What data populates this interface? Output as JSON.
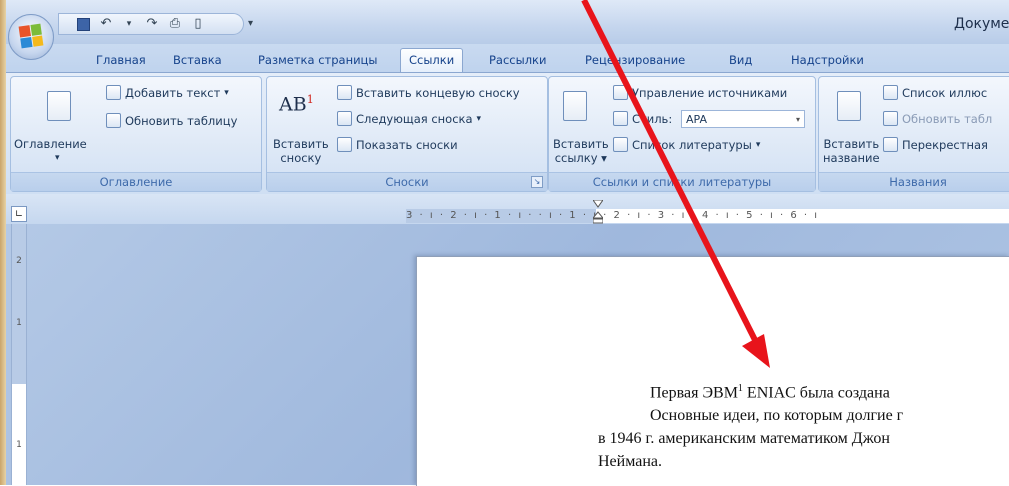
{
  "window": {
    "title": "Докуме"
  },
  "tabs": [
    {
      "label": "Главная"
    },
    {
      "label": "Вставка"
    },
    {
      "label": "Разметка страницы"
    },
    {
      "label": "Ссылки"
    },
    {
      "label": "Рассылки"
    },
    {
      "label": "Рецензирование"
    },
    {
      "label": "Вид"
    },
    {
      "label": "Надстройки"
    }
  ],
  "ribbon": {
    "toc": {
      "title": "Оглавление",
      "button": "Оглавление",
      "add_text": "Добавить текст",
      "update_table": "Обновить таблицу"
    },
    "footnotes": {
      "title": "Сноски",
      "insert_line1": "Вставить",
      "insert_line2": "сноску",
      "insert_endnote": "Вставить концевую сноску",
      "next_footnote": "Следующая сноска",
      "show_notes": "Показать сноски"
    },
    "citations": {
      "title": "Ссылки и списки литературы",
      "insert_line1": "Вставить",
      "insert_line2": "ссылку",
      "manage_sources": "Управление источниками",
      "style_label": "Стиль:",
      "style_value": "APA",
      "bibliography": "Список литературы"
    },
    "captions": {
      "title": "Названия",
      "insert_line1": "Вставить",
      "insert_line2": "название",
      "list_of_figures": "Список иллюс",
      "update_table": "Обновить табл",
      "cross_reference": "Перекрестная"
    }
  },
  "ruler": {
    "text": "3 · ı · 2 · ı · 1 · ı ·   · ı · 1 · ı · 2 · ı · 3 · ı · 4 · ı · 5 · ı · 6 · ı"
  },
  "vertical_ruler": {
    "marks": [
      "2",
      "1",
      "1"
    ]
  },
  "document": {
    "line1_a": "Первая ЭВМ",
    "line1_sup": "1",
    "line1_b": " ENIAC была создана",
    "line2": "Основные идеи, по которым долгие г",
    "line3": "в 1946 г. американским математиком Джон",
    "line4": "Неймана."
  },
  "colors": {
    "annotation_arrow": "#e8141b",
    "ribbon_text": "#1e395b",
    "tab_text": "#15428b"
  }
}
